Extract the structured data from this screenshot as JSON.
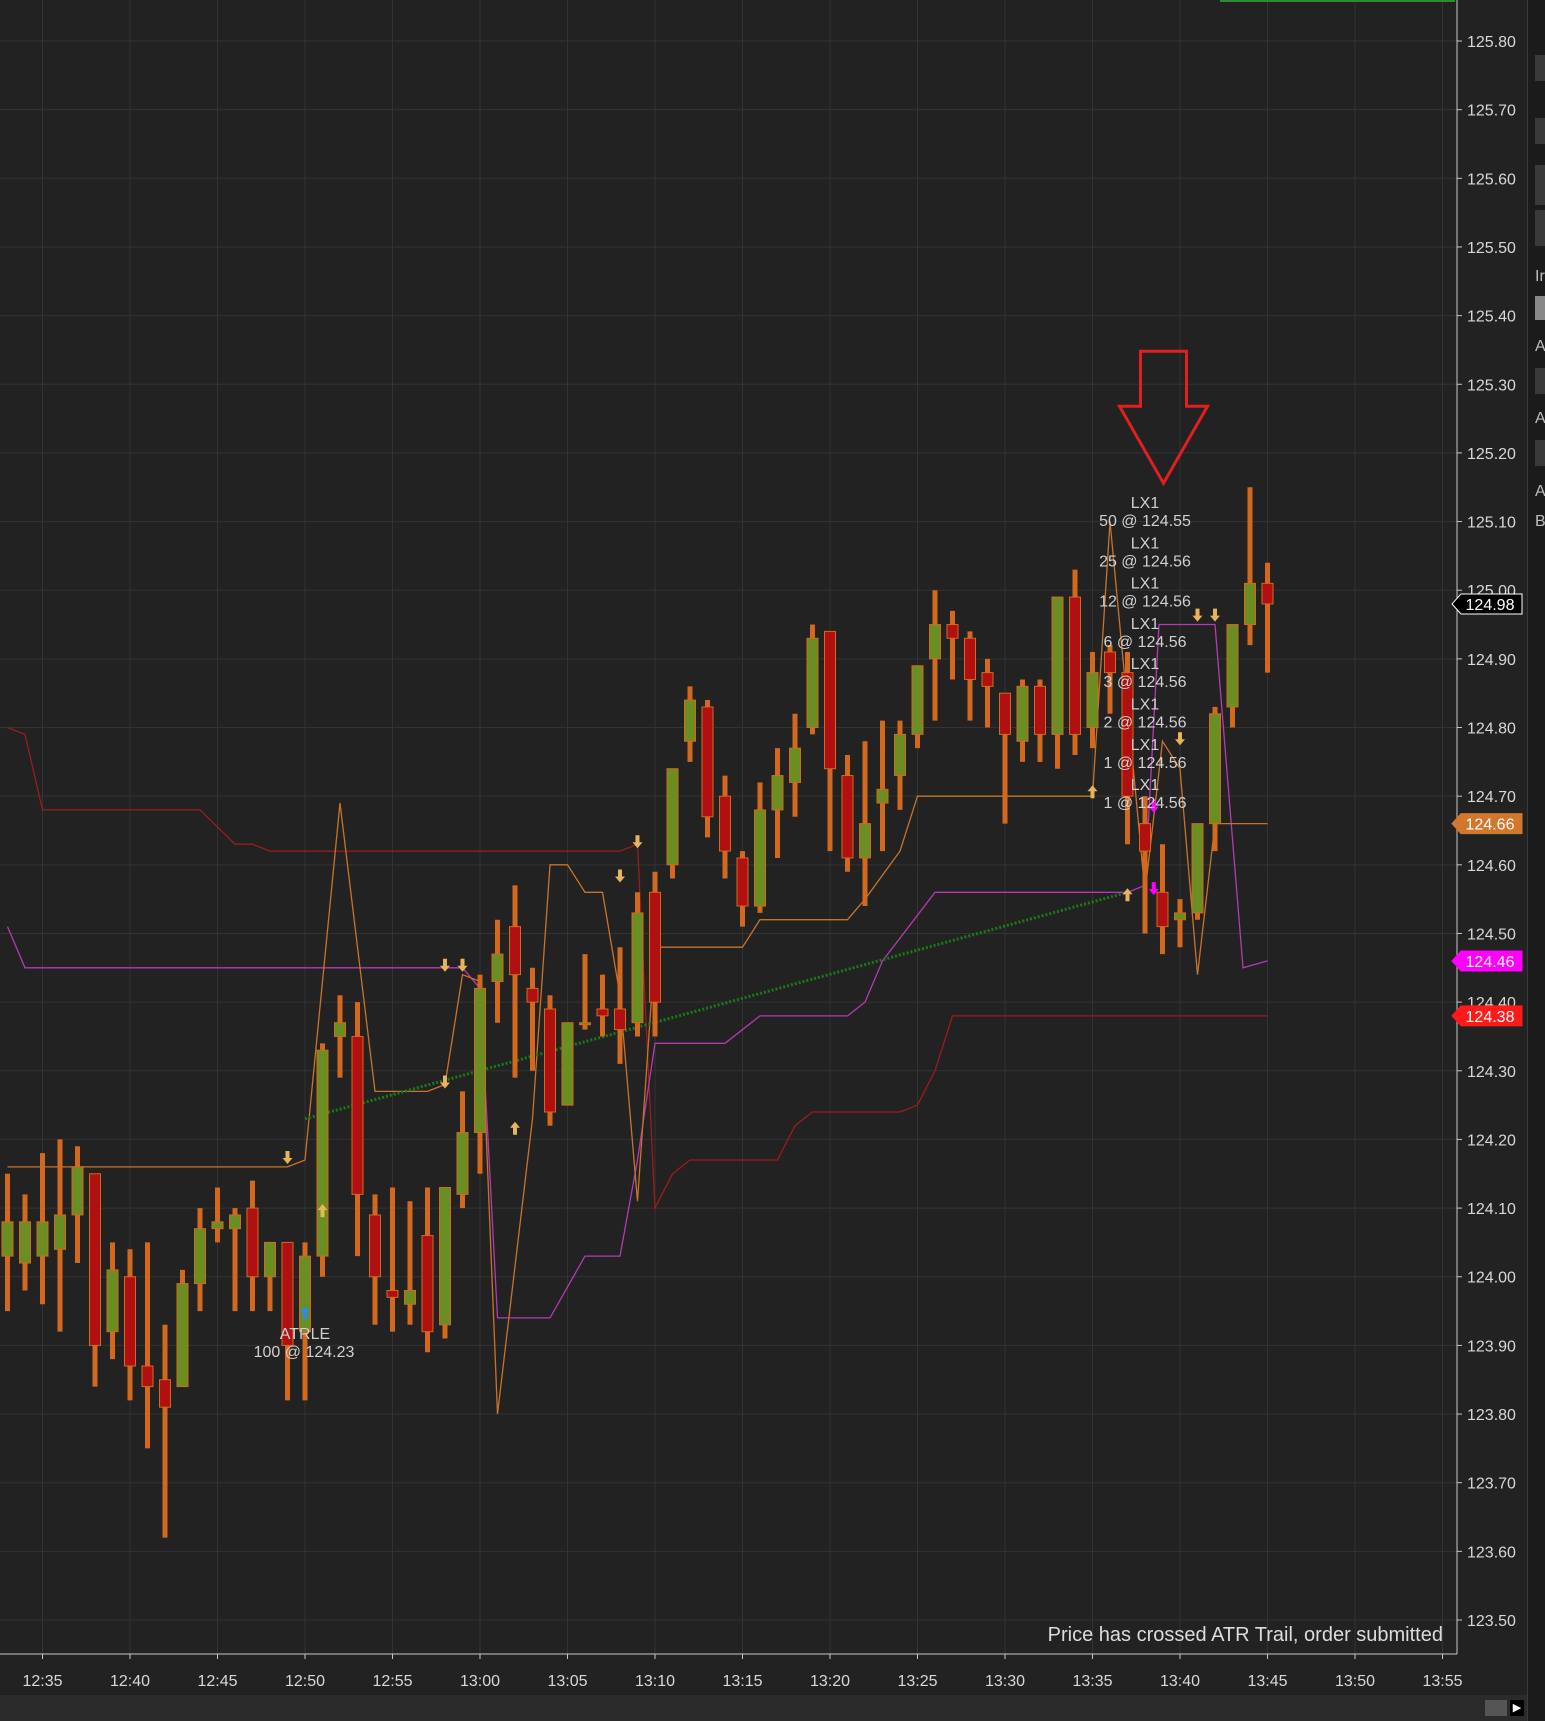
{
  "chart_data": {
    "type": "candlestick",
    "title": "",
    "ylim": [
      123.45,
      125.85
    ],
    "y_ticks": [
      "125.80",
      "125.70",
      "125.60",
      "125.50",
      "125.40",
      "125.30",
      "125.20",
      "125.10",
      "125.00",
      "124.90",
      "124.80",
      "124.70",
      "124.60",
      "124.50",
      "124.40",
      "124.30",
      "124.20",
      "124.10",
      "124.00",
      "123.90",
      "123.80",
      "123.70",
      "123.60",
      "123.50"
    ],
    "x_ticks": [
      "12:35",
      "12:40",
      "12:45",
      "12:50",
      "12:55",
      "13:00",
      "13:05",
      "13:10",
      "13:15",
      "13:20",
      "13:25",
      "13:30",
      "13:35",
      "13:40",
      "13:45",
      "13:50",
      "13:55"
    ],
    "bar_interval_minutes": 1,
    "first_bar_time": "12:32",
    "candles": [
      {
        "o": 124.03,
        "h": 124.15,
        "l": 123.95,
        "c": 124.08
      },
      {
        "o": 124.02,
        "h": 124.12,
        "l": 123.98,
        "c": 124.08
      },
      {
        "o": 124.03,
        "h": 124.18,
        "l": 123.96,
        "c": 124.08
      },
      {
        "o": 124.04,
        "h": 124.2,
        "l": 123.92,
        "c": 124.09
      },
      {
        "o": 124.09,
        "h": 124.19,
        "l": 124.02,
        "c": 124.16
      },
      {
        "o": 124.15,
        "h": 124.15,
        "l": 123.84,
        "c": 123.9
      },
      {
        "o": 123.92,
        "h": 124.05,
        "l": 123.88,
        "c": 124.01
      },
      {
        "o": 124.0,
        "h": 124.04,
        "l": 123.82,
        "c": 123.87
      },
      {
        "o": 123.87,
        "h": 124.05,
        "l": 123.75,
        "c": 123.84
      },
      {
        "o": 123.85,
        "h": 123.93,
        "l": 123.62,
        "c": 123.81
      },
      {
        "o": 123.84,
        "h": 124.01,
        "l": 123.84,
        "c": 123.99
      },
      {
        "o": 123.99,
        "h": 124.1,
        "l": 123.95,
        "c": 124.07
      },
      {
        "o": 124.07,
        "h": 124.13,
        "l": 124.05,
        "c": 124.08
      },
      {
        "o": 124.07,
        "h": 124.1,
        "l": 123.95,
        "c": 124.09
      },
      {
        "o": 124.1,
        "h": 124.14,
        "l": 123.95,
        "c": 124.0
      },
      {
        "o": 124.0,
        "h": 124.05,
        "l": 123.95,
        "c": 124.05
      },
      {
        "o": 124.05,
        "h": 124.05,
        "l": 123.82,
        "c": 123.9
      },
      {
        "o": 123.92,
        "h": 124.05,
        "l": 123.82,
        "c": 124.03
      },
      {
        "o": 124.03,
        "h": 124.34,
        "l": 124.0,
        "c": 124.33
      },
      {
        "o": 124.35,
        "h": 124.41,
        "l": 124.29,
        "c": 124.37
      },
      {
        "o": 124.35,
        "h": 124.4,
        "l": 124.03,
        "c": 124.12
      },
      {
        "o": 124.09,
        "h": 124.12,
        "l": 123.93,
        "c": 124.0
      },
      {
        "o": 123.98,
        "h": 124.13,
        "l": 123.92,
        "c": 123.97
      },
      {
        "o": 123.96,
        "h": 124.11,
        "l": 123.93,
        "c": 123.98
      },
      {
        "o": 124.06,
        "h": 124.13,
        "l": 123.89,
        "c": 123.92
      },
      {
        "o": 123.93,
        "h": 124.13,
        "l": 123.91,
        "c": 124.13
      },
      {
        "o": 124.12,
        "h": 124.27,
        "l": 124.1,
        "c": 124.21
      },
      {
        "o": 124.21,
        "h": 124.44,
        "l": 124.15,
        "c": 124.42
      },
      {
        "o": 124.43,
        "h": 124.52,
        "l": 124.37,
        "c": 124.47
      },
      {
        "o": 124.51,
        "h": 124.57,
        "l": 124.29,
        "c": 124.44
      },
      {
        "o": 124.42,
        "h": 124.45,
        "l": 124.3,
        "c": 124.4
      },
      {
        "o": 124.39,
        "h": 124.41,
        "l": 124.22,
        "c": 124.24
      },
      {
        "o": 124.25,
        "h": 124.37,
        "l": 124.25,
        "c": 124.37
      },
      {
        "o": 124.37,
        "h": 124.47,
        "l": 124.36,
        "c": 124.37
      },
      {
        "o": 124.39,
        "h": 124.44,
        "l": 124.35,
        "c": 124.38
      },
      {
        "o": 124.39,
        "h": 124.48,
        "l": 124.31,
        "c": 124.36
      },
      {
        "o": 124.37,
        "h": 124.56,
        "l": 124.35,
        "c": 124.53
      },
      {
        "o": 124.56,
        "h": 124.59,
        "l": 124.35,
        "c": 124.4
      },
      {
        "o": 124.6,
        "h": 124.74,
        "l": 124.58,
        "c": 124.74
      },
      {
        "o": 124.78,
        "h": 124.86,
        "l": 124.75,
        "c": 124.84
      },
      {
        "o": 124.83,
        "h": 124.84,
        "l": 124.64,
        "c": 124.67
      },
      {
        "o": 124.7,
        "h": 124.73,
        "l": 124.58,
        "c": 124.62
      },
      {
        "o": 124.61,
        "h": 124.62,
        "l": 124.51,
        "c": 124.54
      },
      {
        "o": 124.54,
        "h": 124.72,
        "l": 124.53,
        "c": 124.68
      },
      {
        "o": 124.68,
        "h": 124.77,
        "l": 124.61,
        "c": 124.73
      },
      {
        "o": 124.72,
        "h": 124.82,
        "l": 124.67,
        "c": 124.77
      },
      {
        "o": 124.8,
        "h": 124.95,
        "l": 124.79,
        "c": 124.93
      },
      {
        "o": 124.94,
        "h": 124.94,
        "l": 124.62,
        "c": 124.74
      },
      {
        "o": 124.73,
        "h": 124.76,
        "l": 124.59,
        "c": 124.61
      },
      {
        "o": 124.61,
        "h": 124.78,
        "l": 124.54,
        "c": 124.66
      },
      {
        "o": 124.69,
        "h": 124.81,
        "l": 124.62,
        "c": 124.71
      },
      {
        "o": 124.73,
        "h": 124.81,
        "l": 124.68,
        "c": 124.79
      },
      {
        "o": 124.79,
        "h": 124.89,
        "l": 124.77,
        "c": 124.89
      },
      {
        "o": 124.9,
        "h": 125.0,
        "l": 124.81,
        "c": 124.95
      },
      {
        "o": 124.95,
        "h": 124.97,
        "l": 124.87,
        "c": 124.93
      },
      {
        "o": 124.93,
        "h": 124.94,
        "l": 124.81,
        "c": 124.87
      },
      {
        "o": 124.88,
        "h": 124.9,
        "l": 124.8,
        "c": 124.86
      },
      {
        "o": 124.85,
        "h": 124.85,
        "l": 124.66,
        "c": 124.79
      },
      {
        "o": 124.78,
        "h": 124.87,
        "l": 124.75,
        "c": 124.86
      },
      {
        "o": 124.86,
        "h": 124.87,
        "l": 124.75,
        "c": 124.79
      },
      {
        "o": 124.79,
        "h": 124.99,
        "l": 124.74,
        "c": 124.99
      },
      {
        "o": 124.99,
        "h": 125.03,
        "l": 124.76,
        "c": 124.79
      },
      {
        "o": 124.8,
        "h": 124.91,
        "l": 124.77,
        "c": 124.88
      },
      {
        "o": 124.91,
        "h": 124.92,
        "l": 124.82,
        "c": 124.88
      },
      {
        "o": 124.88,
        "h": 124.91,
        "l": 124.63,
        "c": 124.7
      },
      {
        "o": 124.66,
        "h": 124.7,
        "l": 124.5,
        "c": 124.62
      },
      {
        "o": 124.56,
        "h": 124.63,
        "l": 124.47,
        "c": 124.51
      },
      {
        "o": 124.52,
        "h": 124.55,
        "l": 124.48,
        "c": 124.53
      },
      {
        "o": 124.53,
        "h": 124.66,
        "l": 124.52,
        "c": 124.66
      },
      {
        "o": 124.66,
        "h": 124.83,
        "l": 124.62,
        "c": 124.82
      },
      {
        "o": 124.83,
        "h": 124.95,
        "l": 124.8,
        "c": 124.95
      },
      {
        "o": 124.95,
        "h": 125.15,
        "l": 124.92,
        "c": 125.01
      },
      {
        "o": 125.01,
        "h": 125.04,
        "l": 124.88,
        "c": 124.98
      }
    ],
    "series": [
      {
        "name": "",
        "color": "#9a1c1c",
        "points": [
          [
            0,
            124.8
          ],
          [
            1,
            124.79
          ],
          [
            2,
            124.68
          ],
          [
            11,
            124.68
          ],
          [
            13,
            124.63
          ],
          [
            14,
            124.63
          ],
          [
            15,
            124.62
          ],
          [
            35,
            124.62
          ],
          [
            36,
            124.63
          ],
          [
            37,
            124.1
          ],
          [
            38,
            124.15
          ],
          [
            39,
            124.17
          ],
          [
            44,
            124.17
          ],
          [
            45,
            124.22
          ],
          [
            46,
            124.24
          ],
          [
            51,
            124.24
          ],
          [
            52,
            124.25
          ],
          [
            53,
            124.3
          ],
          [
            54,
            124.38
          ],
          [
            72,
            124.38
          ]
        ]
      },
      {
        "name": "",
        "color": "#b43ab4",
        "points": [
          [
            0,
            124.51
          ],
          [
            1,
            124.45
          ],
          [
            26,
            124.45
          ],
          [
            27,
            124.42
          ],
          [
            28,
            123.94
          ],
          [
            31,
            123.94
          ],
          [
            33,
            124.03
          ],
          [
            35,
            124.03
          ],
          [
            36,
            124.17
          ],
          [
            37,
            124.34
          ],
          [
            41,
            124.34
          ],
          [
            43,
            124.38
          ],
          [
            48,
            124.38
          ],
          [
            49,
            124.4
          ],
          [
            50,
            124.46
          ],
          [
            53,
            124.56
          ],
          [
            64,
            124.56
          ],
          [
            65,
            124.57
          ],
          [
            65.8,
            124.95
          ],
          [
            68,
            124.95
          ],
          [
            69,
            124.95
          ],
          [
            70.6,
            124.45
          ],
          [
            72,
            124.46
          ]
        ]
      },
      {
        "name": "",
        "color": "#c8732a",
        "points": [
          [
            0,
            124.16
          ],
          [
            15,
            124.16
          ],
          [
            16,
            124.16
          ],
          [
            17,
            124.17
          ],
          [
            19,
            124.69
          ],
          [
            21,
            124.27
          ],
          [
            24,
            124.27
          ],
          [
            25,
            124.28
          ],
          [
            26,
            124.44
          ],
          [
            27,
            124.43
          ],
          [
            28,
            123.8
          ],
          [
            30,
            124.23
          ],
          [
            31,
            124.6
          ],
          [
            32,
            124.6
          ],
          [
            33,
            124.56
          ],
          [
            34,
            124.56
          ],
          [
            35,
            124.41
          ],
          [
            36,
            124.11
          ],
          [
            37,
            124.48
          ],
          [
            38,
            124.48
          ],
          [
            42,
            124.48
          ],
          [
            43,
            124.52
          ],
          [
            44,
            124.52
          ],
          [
            45,
            124.52
          ],
          [
            46,
            124.52
          ],
          [
            48,
            124.52
          ],
          [
            49,
            124.55
          ],
          [
            51,
            124.62
          ],
          [
            52,
            124.7
          ],
          [
            55,
            124.7
          ],
          [
            61,
            124.7
          ],
          [
            62,
            124.7
          ],
          [
            63,
            125.1
          ],
          [
            65,
            124.56
          ],
          [
            66,
            124.78
          ],
          [
            67,
            124.74
          ],
          [
            68,
            124.44
          ],
          [
            69,
            124.66
          ],
          [
            72,
            124.66
          ]
        ]
      },
      {
        "name": "",
        "color": "#1a7a1a",
        "points": [
          [
            17,
            124.23
          ],
          [
            64,
            124.56
          ]
        ]
      }
    ],
    "price_badges": [
      {
        "value": "124.98",
        "bg": "#000000",
        "fg": "#ffffff",
        "border": "#ffffff"
      },
      {
        "value": "124.66",
        "bg": "#d2782d",
        "fg": "#ffffff",
        "border": "#d2782d"
      },
      {
        "value": "124.46",
        "bg": "#ff00ff",
        "fg": "#ffffff",
        "border": "#ff00ff"
      },
      {
        "value": "124.38",
        "bg": "#ff1a1a",
        "fg": "#ffffff",
        "border": "#ff1a1a"
      }
    ],
    "entry_annotation": {
      "name": "ATRLE",
      "detail": "100 @ 124.23",
      "bar": 17
    },
    "exit_annotations": [
      {
        "name": "LX1",
        "detail": "50 @ 124.55"
      },
      {
        "name": "LX1",
        "detail": "25 @ 124.56"
      },
      {
        "name": "LX1",
        "detail": "12 @ 124.56"
      },
      {
        "name": "LX1",
        "detail": "6 @ 124.56"
      },
      {
        "name": "LX1",
        "detail": "3 @ 124.56"
      },
      {
        "name": "LX1",
        "detail": "2 @ 124.56"
      },
      {
        "name": "LX1",
        "detail": "1 @ 124.56"
      },
      {
        "name": "LX1",
        "detail": "1 @ 124.56"
      }
    ],
    "trail_markers": [
      {
        "bar": 16,
        "dir": "down",
        "price": 124.17
      },
      {
        "bar": 18,
        "dir": "up",
        "price": 124.1
      },
      {
        "bar": 25,
        "dir": "down",
        "price": 124.45
      },
      {
        "bar": 26,
        "dir": "down",
        "price": 124.45
      },
      {
        "bar": 25,
        "dir": "down",
        "price": 124.28
      },
      {
        "bar": 29,
        "dir": "up",
        "price": 124.22
      },
      {
        "bar": 35,
        "dir": "down",
        "price": 124.58
      },
      {
        "bar": 36,
        "dir": "down",
        "price": 124.63
      },
      {
        "bar": 62,
        "dir": "up",
        "price": 124.71
      },
      {
        "bar": 64,
        "dir": "up",
        "price": 124.56
      },
      {
        "bar": 67,
        "dir": "down",
        "price": 124.78
      },
      {
        "bar": 68,
        "dir": "down",
        "price": 124.96
      },
      {
        "bar": 69,
        "dir": "down",
        "price": 124.96
      }
    ],
    "colors": {
      "up_body": "#6b8e23",
      "down_body": "#b01010",
      "wick": "#d2691e",
      "grid": "#333333",
      "background": "#222222",
      "entry_arrow": "#2e8be6",
      "exit_arrow": "#ff00ff",
      "trail_arrow": "#e8b45a",
      "callout_arrow": "#e02020"
    },
    "callout_arrow_bar": 66,
    "callout_arrow_top_price": 125.3,
    "callout_arrow_tip_price": 125.15
  },
  "status_message": "Price has crossed ATR Trail, order submitted",
  "side_panel_letters": [
    "Ir",
    "A",
    "A",
    "A",
    "B"
  ]
}
